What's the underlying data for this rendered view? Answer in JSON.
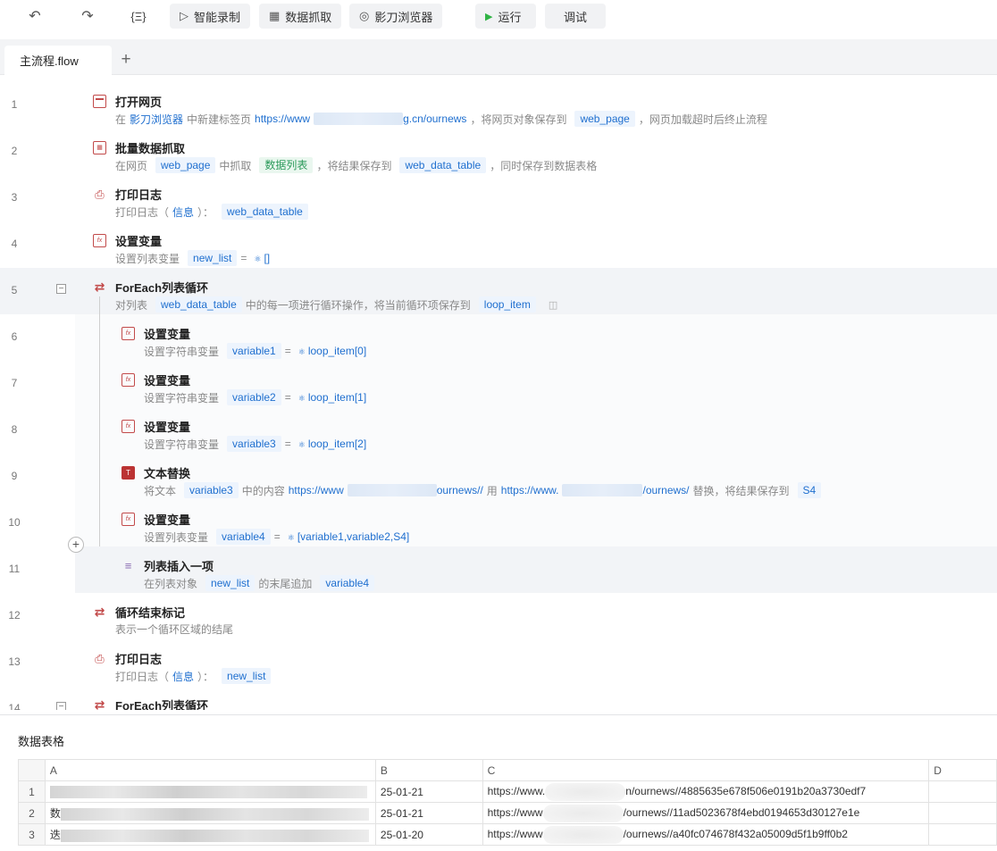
{
  "toolbar": {
    "undo_icon": "undo-icon",
    "redo_icon": "redo-icon",
    "variables_label": "{Ξ}",
    "record_label": "智能录制",
    "scrape_label": "数据抓取",
    "browser_label": "影刀浏览器",
    "run_label": "运行",
    "debug_label": "调试"
  },
  "tabs": {
    "active": "主流程.flow",
    "add": "+"
  },
  "steps": [
    {
      "line": "1",
      "title": "打开网页",
      "d": {
        "a": "在",
        "b": "影刀浏览器",
        "c": "中新建标签页",
        "url1": "https://www",
        "url2": "g.cn/ournews",
        "e": "，将网页对象保存到",
        "f": "web_page",
        "g": "，网页加载超时后终止流程"
      }
    },
    {
      "line": "2",
      "title": "批量数据抓取",
      "d": {
        "a": "在网页",
        "b": "web_page",
        "c": "中抓取",
        "e": "数据列表",
        "f": "，将结果保存到",
        "g": "web_data_table",
        "h": "，同时保存到数据表格"
      }
    },
    {
      "line": "3",
      "title": "打印日志",
      "d": {
        "a": "打印日志（",
        "b": "信息",
        "c": "）：",
        "e": "web_data_table"
      }
    },
    {
      "line": "4",
      "title": "设置变量",
      "d": {
        "a": "设置列表变量",
        "b": "new_list",
        "c": "=",
        "e": "[]"
      }
    },
    {
      "line": "5",
      "title": "ForEach列表循环",
      "d": {
        "a": "对列表",
        "b": "web_data_table",
        "c": "中的每一项进行循环操作，将当前循环项保存到",
        "e": "loop_item"
      }
    },
    {
      "line": "6",
      "title": "设置变量",
      "d": {
        "a": "设置字符串变量",
        "b": "variable1",
        "c": "=",
        "e": "loop_item[0]"
      }
    },
    {
      "line": "7",
      "title": "设置变量",
      "d": {
        "a": "设置字符串变量",
        "b": "variable2",
        "c": "=",
        "e": "loop_item[1]"
      }
    },
    {
      "line": "8",
      "title": "设置变量",
      "d": {
        "a": "设置字符串变量",
        "b": "variable3",
        "c": "=",
        "e": "loop_item[2]"
      }
    },
    {
      "line": "9",
      "title": "文本替换",
      "d": {
        "a": "将文本",
        "b": "variable3",
        "c": "中的内容",
        "u1": "https://www",
        "u2": "ournews//",
        "e": "用",
        "u3": "https://www.",
        "u4": "/ournews/",
        "f": "替换，将结果保存到",
        "g": "S4"
      }
    },
    {
      "line": "10",
      "title": "设置变量",
      "d": {
        "a": "设置列表变量",
        "b": "variable4",
        "c": "=",
        "e": "[variable1,variable2,S4]"
      }
    },
    {
      "line": "11",
      "title": "列表插入一项",
      "d": {
        "a": "在列表对象",
        "b": "new_list",
        "c": "的末尾追加",
        "e": "variable4"
      }
    },
    {
      "line": "12",
      "title": "循环结束标记",
      "d": {
        "a": "表示一个循环区域的结尾"
      }
    },
    {
      "line": "13",
      "title": "打印日志",
      "d": {
        "a": "打印日志（",
        "b": "信息",
        "c": "）：",
        "e": "new_list"
      }
    },
    {
      "line": "14",
      "title": "ForEach列表循环"
    }
  ],
  "panel": {
    "title": "数据表格",
    "columns": [
      "A",
      "B",
      "C",
      "D"
    ],
    "rows": [
      {
        "n": "1",
        "a": "",
        "b": "25-01-21",
        "c1": "https://www.",
        "c2": "n/ournews//4885635e678f506e0191b20a3730edf7"
      },
      {
        "n": "2",
        "a": "数",
        "b": "25-01-21",
        "c1": "https://www",
        "c2": "/ournews//11ad5023678f4ebd0194653d30127e1e"
      },
      {
        "n": "3",
        "a": "迭",
        "b": "25-01-20",
        "c1": "https://www",
        "c2": "/ournews//a40fc074678f432a05009d5f1b9ff0b2"
      }
    ]
  }
}
